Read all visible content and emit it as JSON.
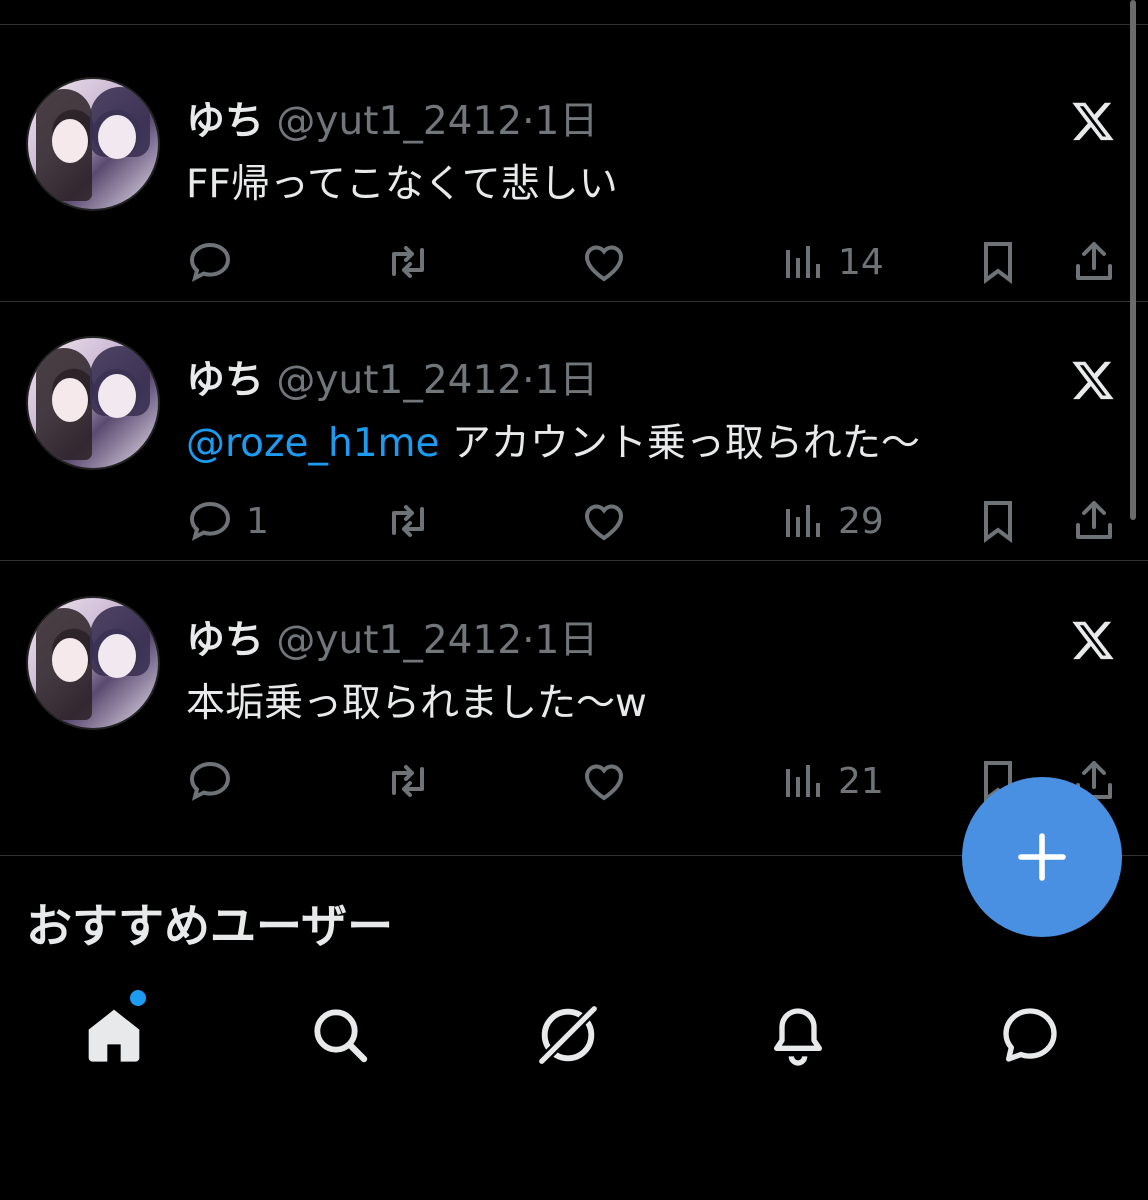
{
  "tweets": [
    {
      "name": "ゆち",
      "handle": "@yut1_2412",
      "separator": "·",
      "time": "1日",
      "mention": "",
      "text": "FF帰ってこなくて悲しい",
      "reply_count": "",
      "views": "14"
    },
    {
      "name": "ゆち",
      "handle": "@yut1_2412",
      "separator": "·",
      "time": "1日",
      "mention": "@roze_h1me",
      "text": " アカウント乗っ取られた〜",
      "reply_count": "1",
      "views": "29"
    },
    {
      "name": "ゆち",
      "handle": "@yut1_2412",
      "separator": "·",
      "time": "1日",
      "mention": "",
      "text": "本垢乗っ取られました〜w",
      "reply_count": "",
      "views": "21"
    }
  ],
  "section_title": "おすすめユーザー",
  "colors": {
    "background": "#000000",
    "accent": "#1d9bf0",
    "fab": "#4a90e2",
    "muted": "#71767b",
    "text": "#e7e9ea"
  },
  "icons": {
    "reply": "reply-icon",
    "retweet": "retweet-icon",
    "like": "like-icon",
    "views": "views-icon",
    "bookmark": "bookmark-icon",
    "share": "share-icon",
    "x_logo": "x-logo-icon",
    "compose": "plus-icon",
    "nav": [
      "home-icon",
      "search-icon",
      "grok-icon",
      "bell-icon",
      "message-icon"
    ]
  }
}
